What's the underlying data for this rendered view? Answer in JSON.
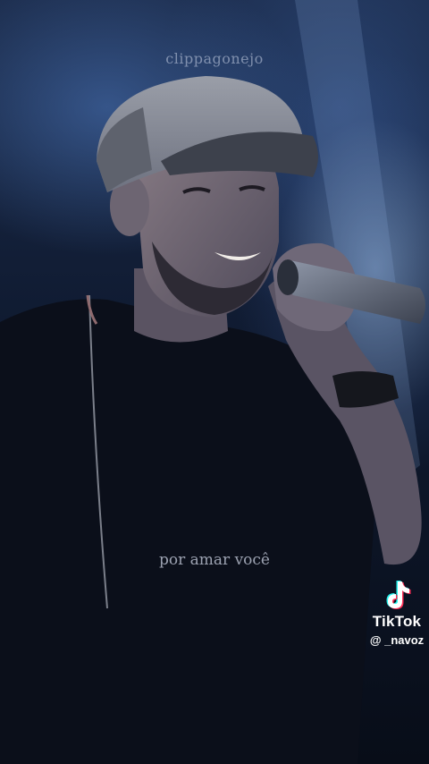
{
  "overlay": {
    "watermark": "clippagonejo",
    "lyric": "por amar você"
  },
  "tiktok": {
    "icon": "tiktok-note-icon",
    "brand": "TikTok",
    "handle": "@ _navoz"
  },
  "colors": {
    "background": "#0f1a30",
    "stage_light": "#9fbbe6",
    "shirt": "#0b0f1a",
    "cap": "#8a8e98",
    "tiktok_cyan": "#25f4ee",
    "tiktok_red": "#fe2c55"
  }
}
